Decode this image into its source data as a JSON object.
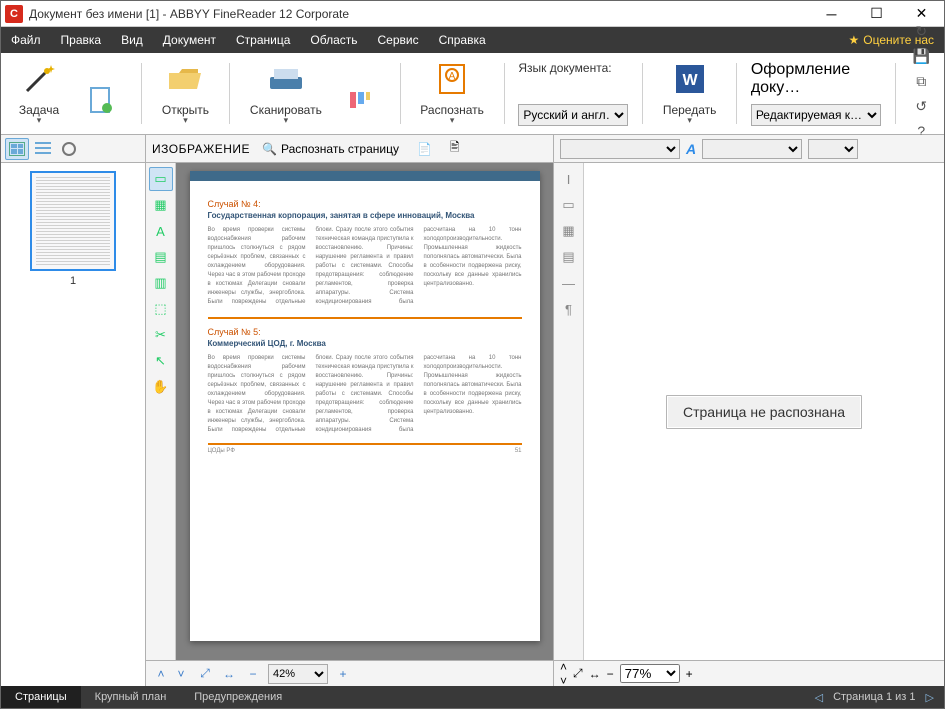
{
  "title": "Документ без имени [1] - ABBYY FineReader 12 Corporate",
  "menubar": [
    "Файл",
    "Правка",
    "Вид",
    "Документ",
    "Страница",
    "Область",
    "Сервис",
    "Справка"
  ],
  "rate_us": "Оцените нас",
  "ribbon": {
    "task": "Задача",
    "open": "Открыть",
    "scan": "Сканировать",
    "recognize": "Распознать",
    "lang_label": "Язык документа:",
    "lang_value": "Русский и англ…",
    "send": "Передать",
    "style_label": "Оформление доку…",
    "style_value": "Редактируемая к…"
  },
  "center": {
    "panel_label": "ИЗОБРАЖЕНИЕ",
    "recognize_page": "Распознать страницу",
    "zoom": "42%"
  },
  "thumb": {
    "number": "1"
  },
  "right": {
    "message": "Страница не распознана",
    "zoom": "77%"
  },
  "article1": {
    "case": "Случай № 4:",
    "title": "Государственная корпорация, занятая в сфере инноваций, Москва"
  },
  "article2": {
    "case": "Случай № 5:",
    "title": "Коммерческий ЦОД, г. Москва"
  },
  "page_footer": {
    "brand": "ЦОДы РФ",
    "page": "51"
  },
  "status": {
    "tabs": [
      "Страницы",
      "Крупный план",
      "Предупреждения"
    ],
    "page_info": "Страница 1 из 1"
  },
  "filler": "Во время проверки системы водоснабжения рабочим пришлось столкнуться с рядом серьёзных проблем, связанных с охлаждением оборудования. Через час в этом рабочем проходе в костюмах Делегации сновали инженеры службы, энергоблока. Были повреждены отдельные блоки. Сразу после этого события техническая команда приступила к восстановлению. Причины: нарушение регламента и правил работы с системами. Способы предотвращения: соблюдение регламентов, проверка аппаратуры. Система кондиционирования была рассчитана на 10 тонн холодопроизводительности. Промышленная жидкость пополнялась автоматически. Была в особенности подвержена риску, поскольку все данные хранились централизованно."
}
